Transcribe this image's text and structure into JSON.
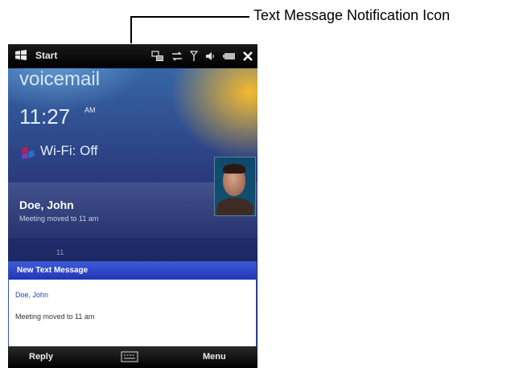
{
  "callout": {
    "label": "Text Message Notification Icon"
  },
  "titlebar": {
    "start_label": "Start"
  },
  "home": {
    "voicemail": "voicemail",
    "time": "11:27",
    "ampm": "AM",
    "wifi": "Wi-Fi: Off",
    "contact_name": "Doe, John",
    "contact_message": "Meeting moved to 11 am",
    "faint_text": "11"
  },
  "notification": {
    "title": "New Text Message",
    "sender": "Doe, John",
    "body": "Meeting moved to 11 am"
  },
  "softkeys": {
    "left": "Reply",
    "right": "Menu"
  },
  "icons": {
    "start": "windows-flag-icon",
    "sms": "text-message-notification-icon",
    "connectivity": "data-connection-icon",
    "signal": "signal-strength-icon",
    "volume": "volume-icon",
    "battery": "battery-icon",
    "close": "close-icon",
    "wifi": "wifi-icon",
    "keyboard": "keyboard-icon"
  },
  "colors": {
    "notification_header": "#2235b5",
    "accent_orange": "#ffbe28"
  }
}
